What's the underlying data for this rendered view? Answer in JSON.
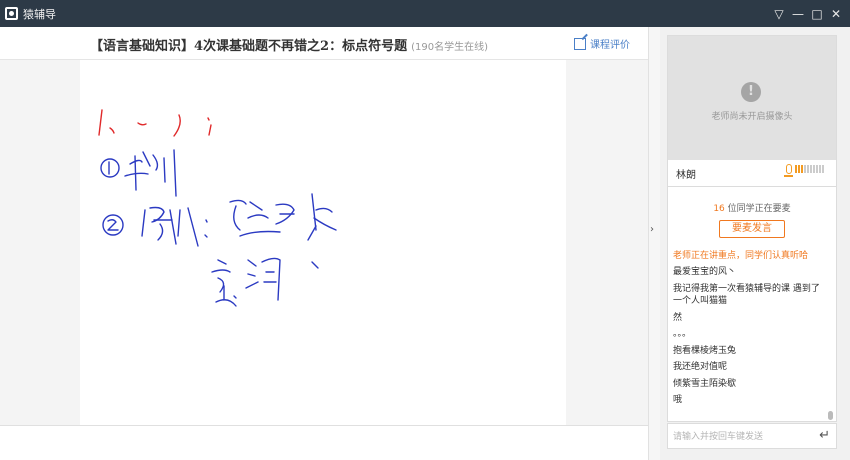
{
  "window": {
    "title": "猿辅导",
    "buttons": [
      "▽",
      "—",
      "□",
      "✕"
    ]
  },
  "header": {
    "course_title": "【语言基础知识】4次课基础题不再错之2：标点符号题",
    "online_count": "(190名学生在线)",
    "evaluate_label": "课程评价"
  },
  "camera": {
    "status_text": "老师尚未开启摄像头",
    "alert_glyph": "!",
    "teacher_name": "林朗",
    "volume_level": 0.3
  },
  "chat": {
    "queue_count": "16",
    "queue_text": "位同学正在要麦",
    "request_button": "要麦发言",
    "notice": "老师正在讲重点，同学们认真听哈",
    "messages": [
      "最爱宝宝的风丶",
      "我记得我第一次看猿辅导的课 遇到了一个人叫猫猫",
      "然",
      "。。。",
      "抱看棵棱烤玉兔",
      "我还绝对值呢",
      "倾紫雪主陌染歇",
      "哦"
    ],
    "input_placeholder": "请输入并按回车键发送",
    "send_glyph": "↵"
  },
  "sidebar_toggle_glyph": "›",
  "colors": {
    "titlebar": "#2d3a47",
    "accent": "#f0781f",
    "link": "#4a7fc7",
    "ink_red": "#e0292a",
    "ink_blue": "#2b3ac2"
  }
}
